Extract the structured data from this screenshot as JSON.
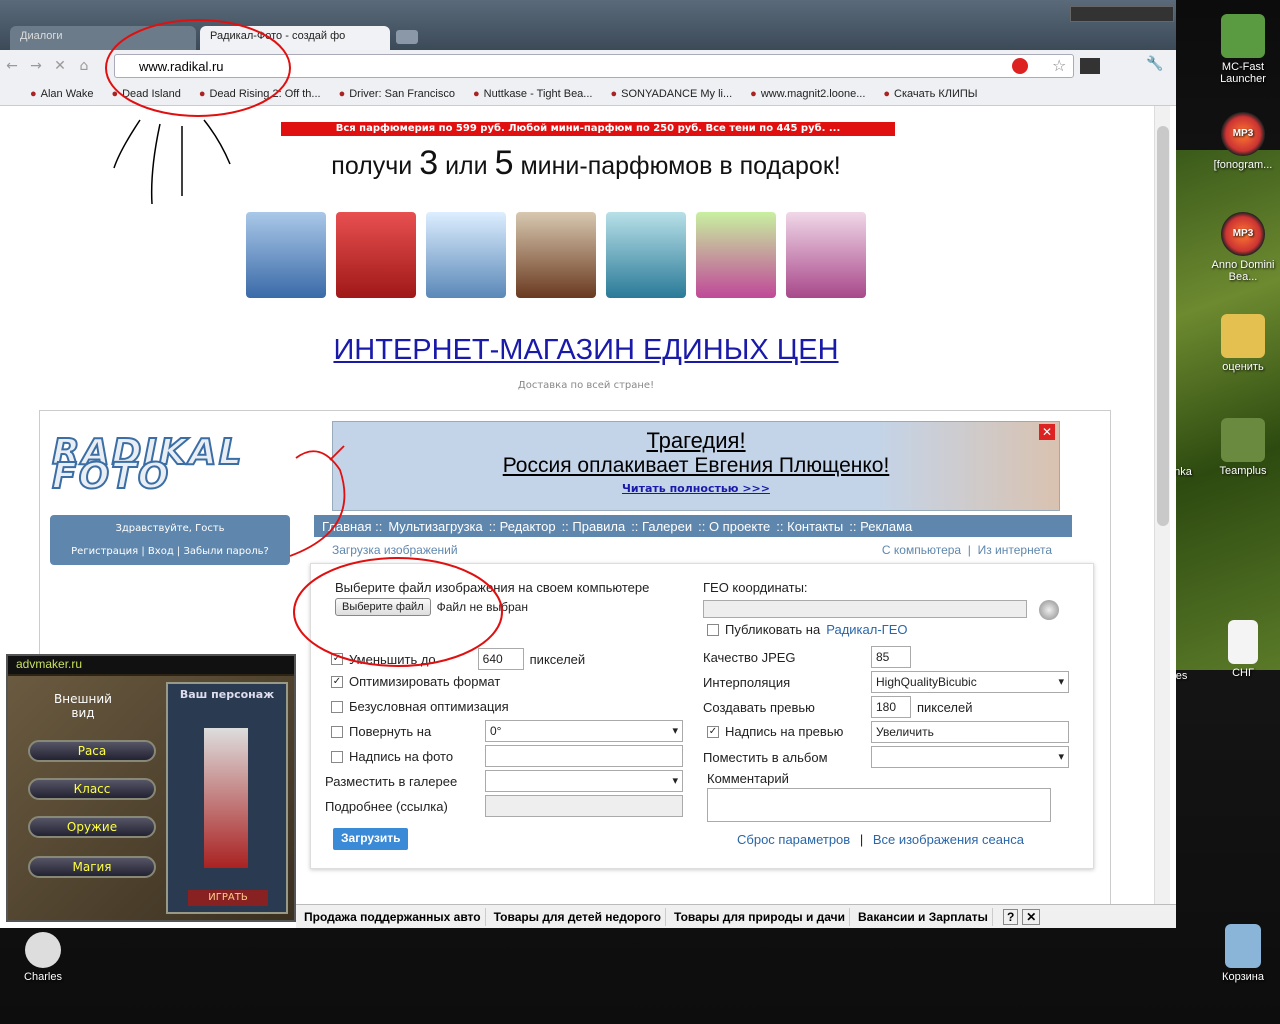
{
  "browser": {
    "tabs": [
      {
        "label": "Диалоги"
      },
      {
        "label": "Радикал-Фото - создай фо"
      }
    ],
    "url": "www.radikal.ru",
    "bookmarks": [
      "Alan Wake",
      "Dead Island",
      "Dead Rising 2: Off th...",
      "Driver: San Francisco",
      "Nuttkase - Tight Bea...",
      "SONYADANCE My li...",
      "www.magnit2.loone...",
      "Скачать КЛИПЫ"
    ]
  },
  "banner": {
    "red_text": "Вся парфюмерия по 599 руб. Любой мини-парфюм по 250 руб. Все тени по 445 руб. ...",
    "promo_pre": "получи",
    "promo_n1": "3",
    "promo_mid": "или",
    "promo_n2": "5",
    "promo_post": "мини-парфюмов в подарок!",
    "shop": "ИНТЕРНЕТ-МАГАЗИН ЕДИНЫХ ЦЕН",
    "delivery": "Доставка по всей стране!"
  },
  "site": {
    "logo": "RADIKAL FOTO",
    "ad_title": "Трагедия!",
    "ad_text": "Россия оплакивает Евгения Плющенко!",
    "ad_link": "Читать полностью >>>",
    "greet": "Здравствуйте, Гость",
    "auth_links": "Регистрация |  Вход |  Забыли пароль?",
    "menu": [
      "Главная ::",
      "Мультизагрузка",
      ":: Редактор",
      ":: Правила",
      ":: Галереи",
      ":: О проекте",
      ":: Контакты",
      ":: Реклама"
    ],
    "sub_left": "Загрузка изображений",
    "sub_right1": "С компьютера",
    "sub_right2": "Из интернета"
  },
  "form": {
    "choose_label": "Выберите файл изображения на своем компьютере",
    "choose_btn": "Выберите файл",
    "no_file": "Файл не выбран",
    "geo_label": "ГЕО координаты:",
    "publish_label": "Публиковать на",
    "publish_link": "Радикал-ГЕО",
    "reduce_label": "Уменьшить до",
    "reduce_value": "640",
    "pixels": "пикселей",
    "optimize": "Оптимизировать формат",
    "uncond": "Безусловная оптимизация",
    "rotate": "Повернуть на",
    "rotate_value": "0°",
    "caption": "Надпись на фото",
    "gallery": "Разместить в галерее",
    "more": "Подробнее (ссылка)",
    "jpeg": "Качество JPEG",
    "jpeg_value": "85",
    "interp": "Интерполяция",
    "interp_value": "HighQualityBicubic",
    "preview": "Создавать превью",
    "preview_value": "180",
    "preview_caption": "Надпись на превью",
    "preview_caption_value": "Увеличить",
    "album": "Поместить в альбом",
    "comment": "Комментарий",
    "upload_btn": "Загрузить",
    "reset": "Сброс параметров",
    "all_images": "Все изображения сеанса"
  },
  "advmaker": {
    "title": "advmaker.ru",
    "appearance": "Внешний вид",
    "buttons": [
      "Раса",
      "Класс",
      "Оружие",
      "Магия"
    ],
    "char": "Ваш персонаж",
    "play": "ИГРАТЬ"
  },
  "bottombar": [
    "Продажа поддержанных авто",
    "Товары для детей недорого",
    "Товары для природы и дачи",
    "Вакансии и Зарплаты"
  ],
  "desktop": {
    "icons": [
      "MC-Fast Launcher",
      "[fonogram...",
      "Anno Domini Bea...",
      "оценить",
      "Teamplus",
      "СНГ",
      "Charles",
      "Корзина"
    ],
    "partial": [
      "anka",
      "tes"
    ]
  }
}
